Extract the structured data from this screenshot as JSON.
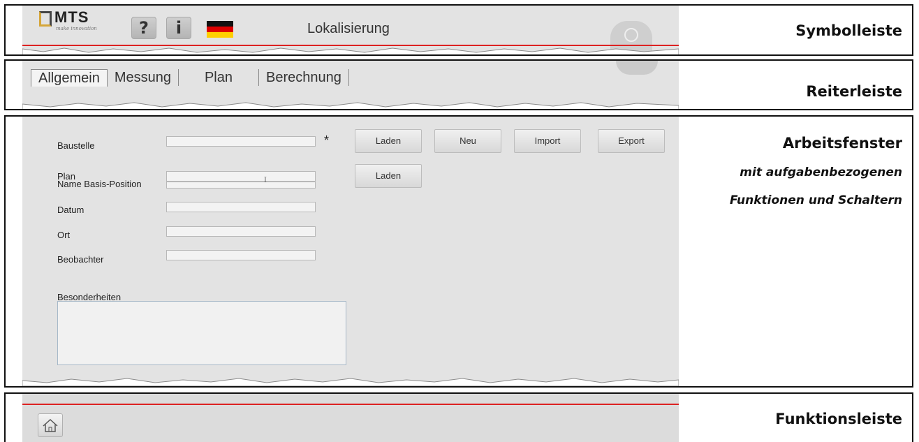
{
  "symbolleiste": {
    "logo_text": "MTS",
    "logo_tagline": "make innovation",
    "help_button": "?",
    "info_button": "i",
    "language_flag": "flag-de-icon",
    "title": "Lokalisierung",
    "power_icon": "power-icon",
    "caption": "Symbolleiste"
  },
  "reiterleiste": {
    "tabs": [
      "Allgemein",
      "Messung",
      "Plan",
      "Berechnung"
    ],
    "caption": "Reiterleiste"
  },
  "arbeitsfenster": {
    "caption": "Arbeitsfenster",
    "subcaption_1": "mit aufgabenbezogenen",
    "subcaption_2": "Funktionen und Schaltern",
    "fields": {
      "baustelle": "Baustelle",
      "plan": "Plan",
      "name_basis_position": "Name Basis-Position",
      "datum": "Datum",
      "ort": "Ort",
      "beobachter": "Beobachter",
      "besonderheiten": "Besonderheiten"
    },
    "required_marker": "*",
    "buttons": {
      "laden_1": "Laden",
      "neu": "Neu",
      "import": "Import",
      "export": "Export",
      "laden_2": "Laden"
    },
    "text_cursor": "I"
  },
  "funktionsleiste": {
    "home_icon": "home-icon",
    "caption": "Funktionsleiste"
  },
  "colors": {
    "accent_red": "#d22222",
    "panel_gray": "#e3e3e3",
    "logo_gold": "#d5a63a"
  }
}
